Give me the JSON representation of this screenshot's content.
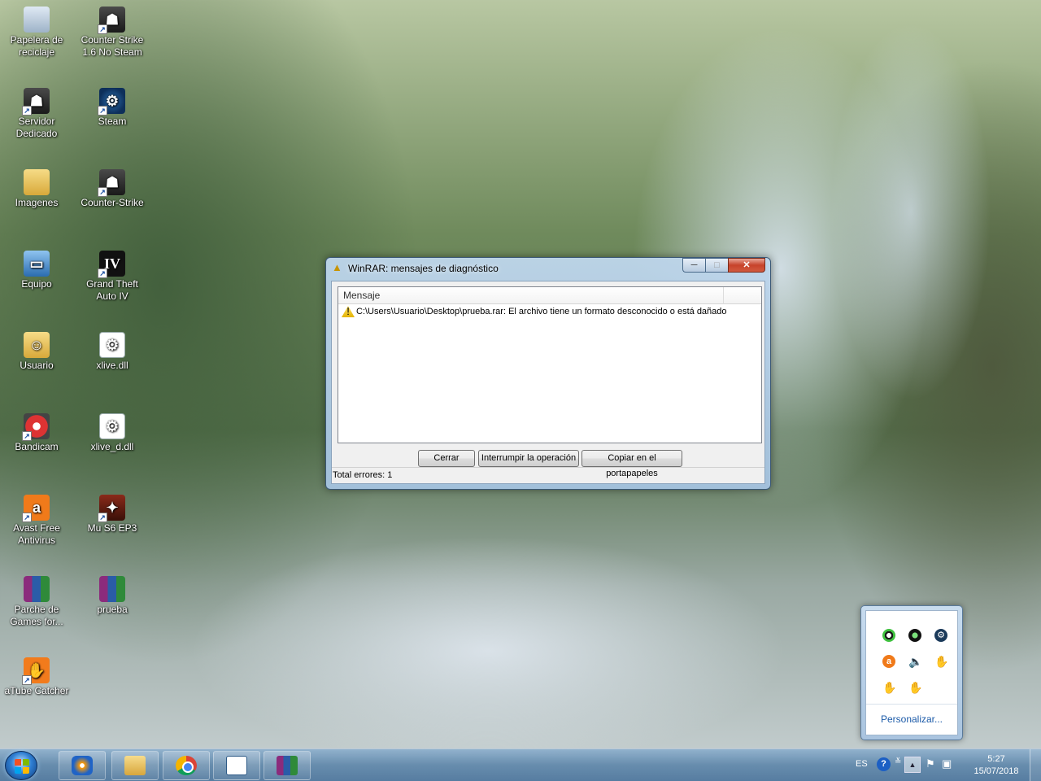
{
  "desktop": {
    "icons": [
      {
        "label": "Papelera de reciclaje",
        "icon": "recycle-bin-icon"
      },
      {
        "label": "Counter Strike 1.6 No Steam",
        "icon": "counter-strike-icon"
      },
      {
        "label": "Servidor Dedicado",
        "icon": "server-icon"
      },
      {
        "label": "Steam",
        "icon": "steam-icon"
      },
      {
        "label": "Imagenes",
        "icon": "folder-icon"
      },
      {
        "label": "Counter-Strike",
        "icon": "counter-strike-icon"
      },
      {
        "label": "Equipo",
        "icon": "computer-icon"
      },
      {
        "label": "Grand Theft Auto IV",
        "icon": "gta-iv-icon"
      },
      {
        "label": "Usuario",
        "icon": "user-folder-icon"
      },
      {
        "label": "xlive.dll",
        "icon": "dll-file-icon"
      },
      {
        "label": "Bandicam",
        "icon": "bandicam-icon"
      },
      {
        "label": "xlive_d.dll",
        "icon": "dll-file-icon"
      },
      {
        "label": "Avast Free Antivirus",
        "icon": "avast-icon"
      },
      {
        "label": "Mu S6 EP3",
        "icon": "mu-online-icon"
      },
      {
        "label": "Parche de Games for...",
        "icon": "winrar-archive-icon"
      },
      {
        "label": "prueba",
        "icon": "winrar-archive-icon"
      },
      {
        "label": "aTube Catcher",
        "icon": "atube-catcher-icon"
      }
    ]
  },
  "dialog": {
    "title": "WinRAR: mensajes de diagnóstico",
    "window_buttons": {
      "minimize": "─",
      "maximize": "□",
      "close": "✕"
    },
    "list": {
      "column_header": "Mensaje",
      "rows": [
        {
          "text": "C:\\Users\\Usuario\\Desktop\\prueba.rar: El archivo tiene un formato desconocido o está dañado",
          "icon": "warning-icon"
        }
      ]
    },
    "buttons": {
      "close": "Cerrar",
      "abort": "Interrumpir la operación",
      "copy": "Copiar en el portapapeles"
    },
    "status": "Total errores: 1"
  },
  "tray_popup": {
    "icons": [
      "bandicam-tray-icon",
      "recording-tray-icon",
      "steam-tray-icon",
      "avast-tray-icon",
      "volume-icon",
      "hand-tray-icon",
      "hand-tray-icon",
      "hand-tray-icon"
    ],
    "customize_link": "Personalizar..."
  },
  "taskbar": {
    "apps": [
      "media-player-icon",
      "file-explorer-icon",
      "chrome-icon",
      "app-window-icon",
      "winrar-icon"
    ],
    "language": "ES",
    "help_glyph": "?",
    "time": "5:27",
    "date": "15/07/2018"
  }
}
